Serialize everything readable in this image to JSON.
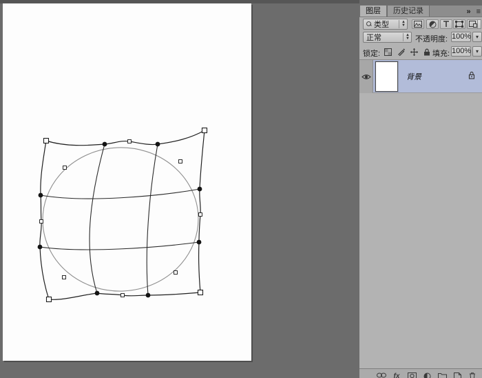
{
  "colors": {
    "workspace_bg": "#6c6c6c",
    "panel_bg": "#b3b3b3",
    "selected_layer_row": "#b2bcd9",
    "canvas_bg": "#ffffff",
    "warp_grid_stroke": "#1f1f1f",
    "circle_stroke": "#8f8f8f"
  },
  "icons": {
    "dropdown_arrow": "▾",
    "spinner_up": "▲",
    "spinner_down": "▼",
    "collapse": "»",
    "panel_menu": "≡"
  },
  "panel": {
    "tabs": [
      {
        "label": "图层"
      },
      {
        "label": "历史记录"
      }
    ],
    "filter": {
      "kind_label": "类型"
    },
    "blend": {
      "mode": "正常",
      "opacity_label": "不透明度:",
      "opacity_value": "100%"
    },
    "lock": {
      "label": "锁定:",
      "fill_label": "填充:",
      "fill_value": "100%"
    },
    "layers": [
      {
        "name": "背景"
      }
    ],
    "footer": {
      "fx_label": "fx"
    }
  }
}
